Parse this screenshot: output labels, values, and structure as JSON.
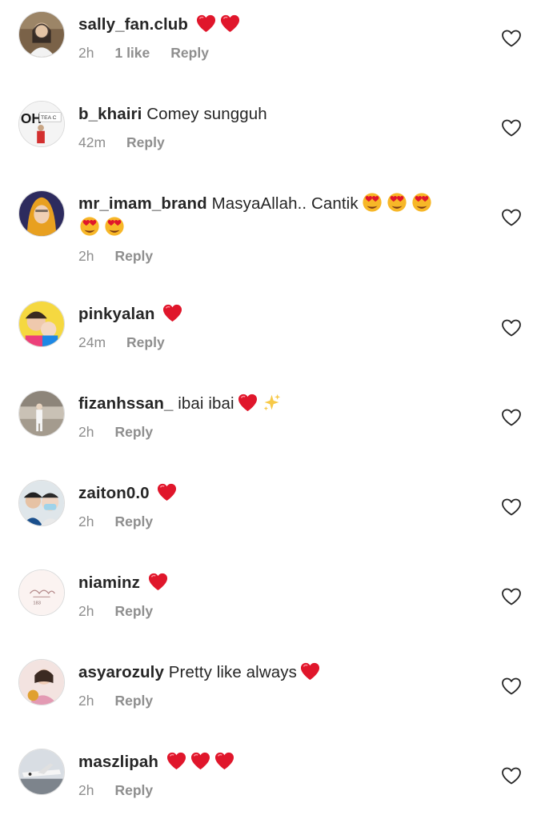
{
  "comments": [
    {
      "username": "sally_fan.club",
      "text": "",
      "emojis": [
        "red-heart",
        "red-heart"
      ],
      "emojis2": [],
      "time": "2h",
      "likes": "1 like",
      "reply": "Reply"
    },
    {
      "username": "b_khairi",
      "text": "Comey sungguh",
      "emojis": [],
      "emojis2": [],
      "time": "42m",
      "likes": "",
      "reply": "Reply"
    },
    {
      "username": "mr_imam_brand",
      "text": "MasyaAllah.. Cantik",
      "emojis": [
        "heart-eyes",
        "heart-eyes",
        "heart-eyes"
      ],
      "emojis2": [
        "heart-eyes",
        "heart-eyes"
      ],
      "time": "2h",
      "likes": "",
      "reply": "Reply"
    },
    {
      "username": "pinkyalan",
      "text": "",
      "emojis": [
        "red-heart"
      ],
      "emojis2": [],
      "time": "24m",
      "likes": "",
      "reply": "Reply"
    },
    {
      "username": "fizanhssan_",
      "text": "ibai ibai",
      "emojis": [
        "red-heart",
        "sparkles"
      ],
      "emojis2": [],
      "time": "2h",
      "likes": "",
      "reply": "Reply"
    },
    {
      "username": "zaiton0.0",
      "text": "",
      "emojis": [
        "red-heart"
      ],
      "emojis2": [],
      "time": "2h",
      "likes": "",
      "reply": "Reply"
    },
    {
      "username": "niaminz",
      "text": "",
      "emojis": [
        "red-heart"
      ],
      "emojis2": [],
      "time": "2h",
      "likes": "",
      "reply": "Reply"
    },
    {
      "username": "asyarozuly",
      "text": "Pretty like always",
      "emojis": [
        "red-heart"
      ],
      "emojis2": [],
      "time": "2h",
      "likes": "",
      "reply": "Reply"
    },
    {
      "username": "maszlipah",
      "text": "",
      "emojis": [
        "red-heart",
        "red-heart",
        "red-heart"
      ],
      "emojis2": [],
      "time": "2h",
      "likes": "",
      "reply": "Reply"
    }
  ],
  "icons": {
    "like": "heart-outline-icon"
  },
  "colors": {
    "meta": "#8e8e8e",
    "username": "#262626",
    "heart": "#e0162b"
  }
}
